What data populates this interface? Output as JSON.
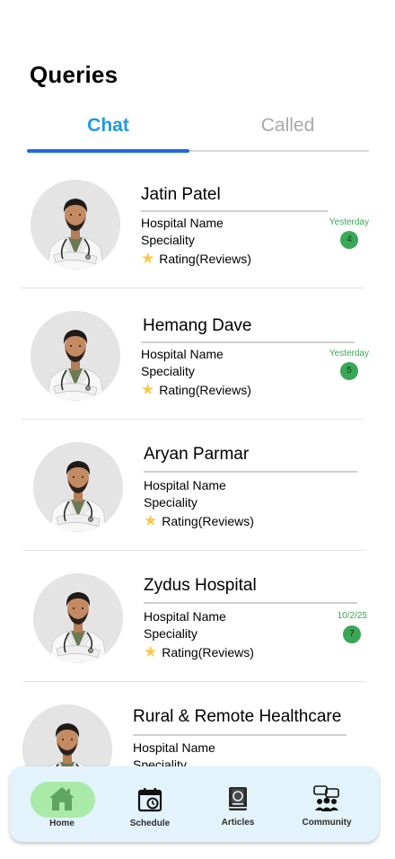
{
  "page": {
    "title": "Queries"
  },
  "tabs": [
    {
      "label": "Chat",
      "active": true
    },
    {
      "label": "Called",
      "active": false
    }
  ],
  "doctors": [
    {
      "name": "Jatin Patel",
      "hospital": "Hospital Name",
      "speciality": "Speciality",
      "rating": "Rating(Reviews)",
      "date": "Yesterday",
      "unread": "4"
    },
    {
      "name": "Hemang Dave",
      "hospital": "Hospital Name",
      "speciality": "Speciality",
      "rating": "Rating(Reviews)",
      "date": "Yesterday",
      "unread": "5"
    },
    {
      "name": "Aryan Parmar",
      "hospital": "Hospital Name",
      "speciality": "Speciality",
      "rating": "Rating(Reviews)",
      "date": "",
      "unread": ""
    },
    {
      "name": "Zydus Hospital",
      "hospital": "Hospital Name",
      "speciality": "Speciality",
      "rating": "Rating(Reviews)",
      "date": "10/2/25",
      "unread": "7"
    },
    {
      "name": "Rural & Remote Healthcare",
      "hospital": "Hospital Name",
      "speciality": "Speciality",
      "rating": "",
      "date": "",
      "unread": ""
    }
  ],
  "nav": [
    {
      "label": "Home",
      "icon": "home-icon",
      "active": true
    },
    {
      "label": "Schedule",
      "icon": "calendar-icon",
      "active": false
    },
    {
      "label": "Articles",
      "icon": "book-icon",
      "active": false
    },
    {
      "label": "Community",
      "icon": "community-icon",
      "active": false
    }
  ],
  "colors": {
    "accent": "#1f6ae0",
    "tab_active": "#1e9be4",
    "badge": "#3aa757",
    "nav_bg": "#e3f3fb",
    "home_pill": "#a9eaa9"
  }
}
